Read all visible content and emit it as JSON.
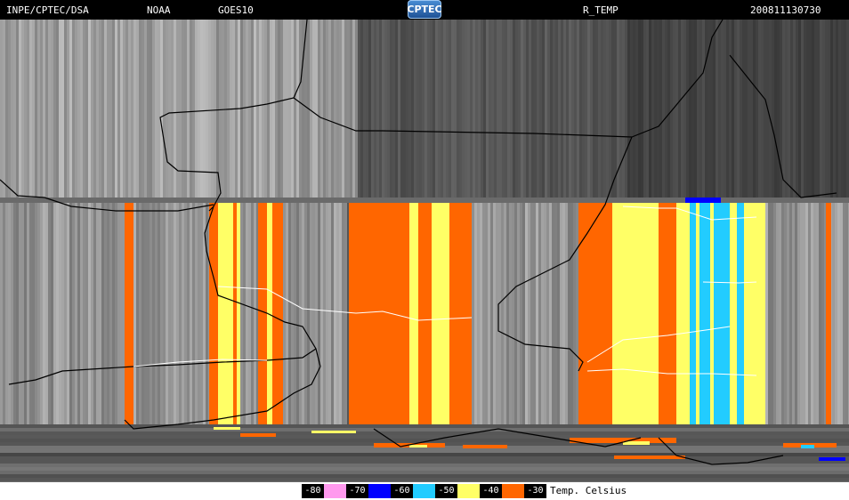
{
  "header": {
    "left": "INPE/CPTEC/DSA",
    "agency": "NOAA",
    "satellite": "GOES10",
    "logo": "CPTEC",
    "product": "R_TEMP",
    "timestamp": "200811130730"
  },
  "legend": {
    "title": "Temp. Celsius",
    "entries": [
      {
        "label": "-80",
        "color": "#ff99ee"
      },
      {
        "label": "-70",
        "color": "#0000ff"
      },
      {
        "label": "-60",
        "color": "#22ccff"
      },
      {
        "label": "-50",
        "color": "#ffff66"
      },
      {
        "label": "-40",
        "color": "#ff6600"
      },
      {
        "label": "-30",
        "color": ""
      }
    ]
  },
  "colors": {
    "background": "#000000",
    "map_base": "#8a8a8a",
    "borders": "#000000",
    "coastline": "#ffffff"
  }
}
